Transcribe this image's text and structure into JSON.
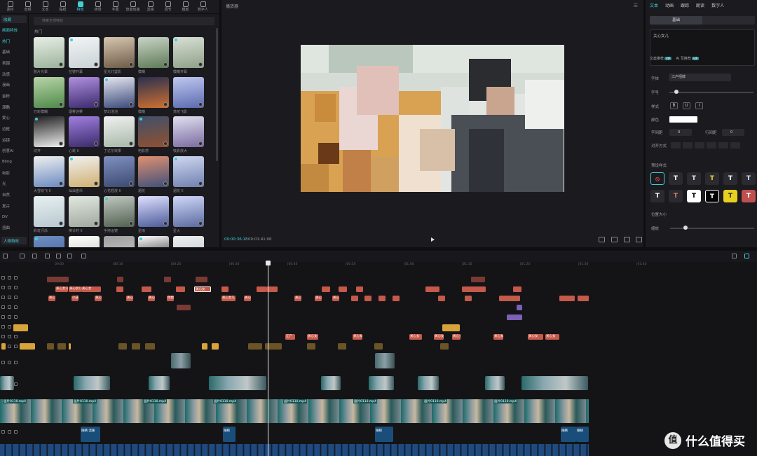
{
  "toolbar": {
    "tabs": [
      "素材",
      "音频",
      "文本",
      "贴纸",
      "特效",
      "转场",
      "字幕",
      "智能包装",
      "滤镜",
      "调节",
      "模板",
      "数字人"
    ],
    "active_index": 4
  },
  "left_nav": {
    "selected_dropdown": "收藏",
    "category_dropdown": "画面特效",
    "items": [
      "热门",
      "基础",
      "氛围",
      "动感",
      "漫画",
      "金粉",
      "潮酷",
      "爱心",
      "边框",
      "运镜",
      "创意AI",
      "Bling",
      "电影",
      "光",
      "自然",
      "复古",
      "DV",
      "扭曲"
    ],
    "bottom_dropdown": "人物特效"
  },
  "effects": {
    "search_placeholder": "搜索全部特效",
    "section": "热门",
    "cards": [
      "胶片光晕",
      "拉镜开幕",
      "星光灯盏影",
      "模糊",
      "模糊开幕",
      "万彩模糊",
      "烟雾迷雾",
      "梦幻泡泡",
      "模糊",
      "落花飞影",
      "切开",
      "心跳 II",
      "丁达尔效果",
      "电影感",
      "吸影放大",
      "大雪纷飞 II",
      "灿灿金币",
      "心花怒放 II",
      "烟花",
      "烟花 II",
      "彩虹闪烁",
      "倒计时 II",
      "手持运镜",
      "星雨",
      "星火",
      "",
      "",
      "",
      "",
      ""
    ]
  },
  "player": {
    "title": "播放器",
    "current_time": "00:00:36:18",
    "total_time": "00:01:41:06"
  },
  "inspector": {
    "tabs": [
      "文本",
      "动画",
      "跟踪",
      "朗读",
      "数字人"
    ],
    "active_tab": "文本",
    "subtabs": [
      "基础",
      ""
    ],
    "text_content": "关心女儿",
    "tool_recognize": "文案推荐",
    "tool_ai": "AI 写推荐",
    "vip_badge": "VIP",
    "font_label": "字体",
    "font_value": "江户招牌",
    "size_label": "字号",
    "style_label": "样式",
    "style_b": "B",
    "style_u": "U",
    "style_i": "I",
    "color_label": "颜色",
    "char_spacing_label": "字间距",
    "char_spacing_value": "0",
    "line_spacing_label": "行间距",
    "line_spacing_value": "0",
    "align_label": "对齐方式",
    "preset_label": "预设样式",
    "position_label": "位置大小",
    "scale_label": "缩放",
    "preset_glyph": "T"
  },
  "timeline": {
    "ruler_ticks": [
      "00:00",
      "|00:10",
      "|00:20",
      "|00:30",
      "|00:40",
      "|00:50",
      "|01:00",
      "|01:10",
      "|01:20",
      "|01:30",
      "|01:40"
    ],
    "main_label": "封",
    "text_clips_row1": [
      "关心女儿",
      "关心女儿",
      "关心女",
      "关心女儿"
    ],
    "text_clips_row2": [
      "关心女儿",
      "小成长",
      "关心女儿",
      "关心女儿",
      "关心女儿",
      "你想说",
      "关心女儿",
      "关心女儿",
      "关心女儿",
      "关心女儿",
      "关心女儿"
    ],
    "text_clips_row3": [
      "江户",
      "关心女",
      "关心女儿",
      "关心女",
      "关心女",
      "关心女",
      "关心女",
      "关心女",
      "关心女",
      "小成长",
      "天使"
    ],
    "main_clips": [
      "画片0110.mp4",
      "画片0110.mp4",
      "画片0110.mp4",
      "画片0110.mp4",
      "画片0110.mp4",
      "画片0110.mp4",
      "画片0110.mp4",
      "画片0110.mp4"
    ],
    "audio_clips": [
      "眼睛 温暖",
      "眼睛",
      "眼睛",
      "眼睛",
      "眼睛"
    ]
  },
  "watermark": {
    "logo": "值",
    "text": "什么值得买"
  },
  "colors": {
    "accent": "#3fd0d8",
    "text_clip": "#c5594a",
    "sticker_clip": "#d8a43a",
    "effect_clip": "#7d5fb5",
    "main_track": "#1c6e6e"
  }
}
